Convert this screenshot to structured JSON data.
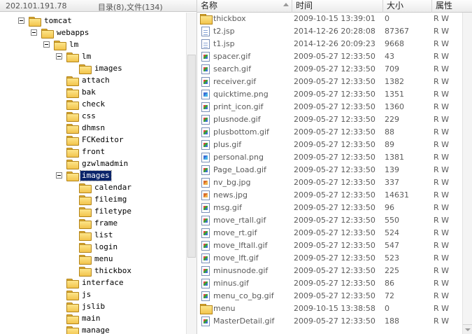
{
  "header": {
    "ip": "202.101.191.78",
    "counts": "目录(8),文件(134)"
  },
  "tree": [
    {
      "label": "tomcat",
      "expander": true,
      "selected": false
    },
    {
      "label": "webapps",
      "expander": true,
      "selected": false
    },
    {
      "label": "lm",
      "expander": true,
      "selected": false
    },
    {
      "label": "lm",
      "expander": true,
      "selected": false
    },
    {
      "label": "images",
      "expander": false,
      "selected": false
    },
    {
      "label": "attach",
      "expander": false,
      "selected": false
    },
    {
      "label": "bak",
      "expander": false,
      "selected": false
    },
    {
      "label": "check",
      "expander": false,
      "selected": false
    },
    {
      "label": "css",
      "expander": false,
      "selected": false
    },
    {
      "label": "dhmsn",
      "expander": false,
      "selected": false
    },
    {
      "label": "FCKeditor",
      "expander": false,
      "selected": false
    },
    {
      "label": "front",
      "expander": false,
      "selected": false
    },
    {
      "label": "gzwlmadmin",
      "expander": false,
      "selected": false
    },
    {
      "label": "images",
      "expander": true,
      "selected": true
    },
    {
      "label": "calendar",
      "expander": false,
      "selected": false
    },
    {
      "label": "fileimg",
      "expander": false,
      "selected": false
    },
    {
      "label": "filetype",
      "expander": false,
      "selected": false
    },
    {
      "label": "frame",
      "expander": false,
      "selected": false
    },
    {
      "label": "list",
      "expander": false,
      "selected": false
    },
    {
      "label": "login",
      "expander": false,
      "selected": false
    },
    {
      "label": "menu",
      "expander": false,
      "selected": false
    },
    {
      "label": "thickbox",
      "expander": false,
      "selected": false
    },
    {
      "label": "interface",
      "expander": false,
      "selected": false
    },
    {
      "label": "js",
      "expander": false,
      "selected": false
    },
    {
      "label": "jslib",
      "expander": false,
      "selected": false
    },
    {
      "label": "main",
      "expander": false,
      "selected": false
    },
    {
      "label": "manage",
      "expander": false,
      "selected": false
    }
  ],
  "columns": {
    "name": "名称",
    "time": "时间",
    "size": "大小",
    "attr": "属性"
  },
  "files": [
    {
      "icon": "folder",
      "name": "thickbox",
      "time": "2009-10-15 13:39:01",
      "size": "0",
      "attr": "R W"
    },
    {
      "icon": "jsp",
      "name": "t2.jsp",
      "time": "2014-12-26 20:28:08",
      "size": "87367",
      "attr": "R W"
    },
    {
      "icon": "jsp",
      "name": "t1.jsp",
      "time": "2014-12-26 20:09:23",
      "size": "9668",
      "attr": "R W"
    },
    {
      "icon": "gif",
      "name": "spacer.gif",
      "time": "2009-05-27 12:33:50",
      "size": "43",
      "attr": "R W"
    },
    {
      "icon": "gif",
      "name": "search.gif",
      "time": "2009-05-27 12:33:50",
      "size": "709",
      "attr": "R W"
    },
    {
      "icon": "gif",
      "name": "receiver.gif",
      "time": "2009-05-27 12:33:50",
      "size": "1382",
      "attr": "R W"
    },
    {
      "icon": "png",
      "name": "quicktime.png",
      "time": "2009-05-27 12:33:50",
      "size": "1351",
      "attr": "R W"
    },
    {
      "icon": "gif",
      "name": "print_icon.gif",
      "time": "2009-05-27 12:33:50",
      "size": "1360",
      "attr": "R W"
    },
    {
      "icon": "gif",
      "name": "plusnode.gif",
      "time": "2009-05-27 12:33:50",
      "size": "229",
      "attr": "R W"
    },
    {
      "icon": "gif",
      "name": "plusbottom.gif",
      "time": "2009-05-27 12:33:50",
      "size": "88",
      "attr": "R W"
    },
    {
      "icon": "gif",
      "name": "plus.gif",
      "time": "2009-05-27 12:33:50",
      "size": "89",
      "attr": "R W"
    },
    {
      "icon": "png",
      "name": "personal.png",
      "time": "2009-05-27 12:33:50",
      "size": "1381",
      "attr": "R W"
    },
    {
      "icon": "gif",
      "name": "Page_Load.gif",
      "time": "2009-05-27 12:33:50",
      "size": "139",
      "attr": "R W"
    },
    {
      "icon": "jpg",
      "name": "nv_bg.jpg",
      "time": "2009-05-27 12:33:50",
      "size": "337",
      "attr": "R W"
    },
    {
      "icon": "jpg",
      "name": "news.jpg",
      "time": "2009-05-27 12:33:50",
      "size": "14631",
      "attr": "R W"
    },
    {
      "icon": "gif",
      "name": "msg.gif",
      "time": "2009-05-27 12:33:50",
      "size": "96",
      "attr": "R W"
    },
    {
      "icon": "gif",
      "name": "move_rtall.gif",
      "time": "2009-05-27 12:33:50",
      "size": "550",
      "attr": "R W"
    },
    {
      "icon": "gif",
      "name": "move_rt.gif",
      "time": "2009-05-27 12:33:50",
      "size": "524",
      "attr": "R W"
    },
    {
      "icon": "gif",
      "name": "move_lftall.gif",
      "time": "2009-05-27 12:33:50",
      "size": "547",
      "attr": "R W"
    },
    {
      "icon": "gif",
      "name": "move_lft.gif",
      "time": "2009-05-27 12:33:50",
      "size": "523",
      "attr": "R W"
    },
    {
      "icon": "gif",
      "name": "minusnode.gif",
      "time": "2009-05-27 12:33:50",
      "size": "225",
      "attr": "R W"
    },
    {
      "icon": "gif",
      "name": "minus.gif",
      "time": "2009-05-27 12:33:50",
      "size": "86",
      "attr": "R W"
    },
    {
      "icon": "gif",
      "name": "menu_co_bg.gif",
      "time": "2009-05-27 12:33:50",
      "size": "72",
      "attr": "R W"
    },
    {
      "icon": "folder",
      "name": "menu",
      "time": "2009-10-15 13:38:58",
      "size": "0",
      "attr": "R W"
    },
    {
      "icon": "gif",
      "name": "MasterDetail.gif",
      "time": "2009-05-27 12:33:50",
      "size": "188",
      "attr": "R W"
    }
  ]
}
